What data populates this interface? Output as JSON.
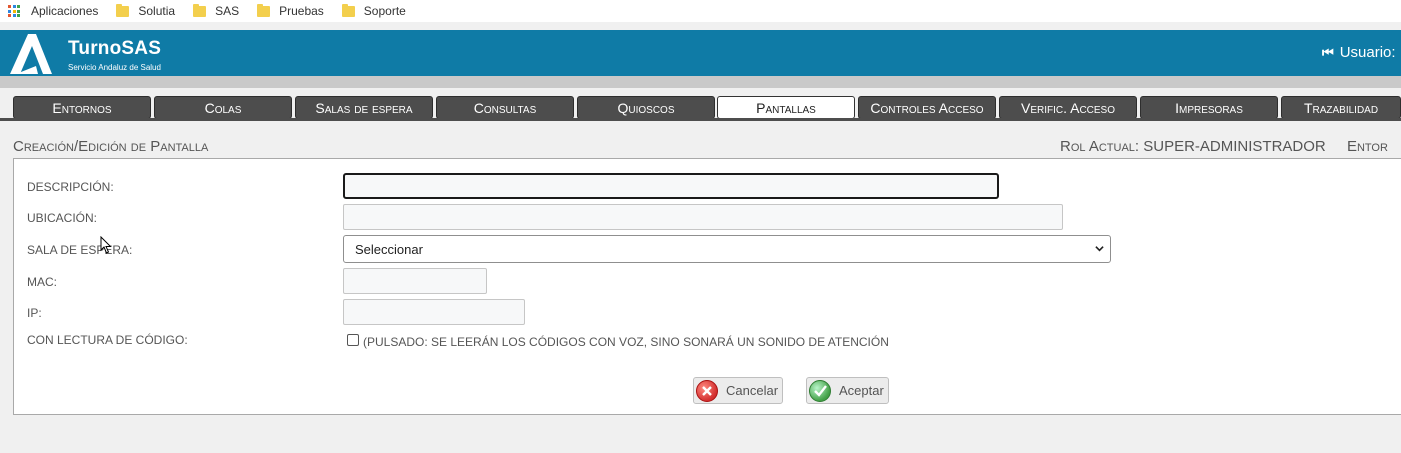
{
  "bookmarks": {
    "items": [
      {
        "label": "Aplicaciones",
        "icon": "apps-grid-icon"
      },
      {
        "label": "Solutia",
        "icon": "folder-icon"
      },
      {
        "label": "SAS",
        "icon": "folder-icon"
      },
      {
        "label": "Pruebas",
        "icon": "folder-icon"
      },
      {
        "label": "Soporte",
        "icon": "folder-icon"
      }
    ]
  },
  "header": {
    "title": "TurnoSAS",
    "subtitle": "Servicio Andaluz de Salud",
    "user_label": "Usuario:",
    "bg_color": "#0f7ba6"
  },
  "tabs": [
    {
      "label": "Entornos"
    },
    {
      "label": "Colas"
    },
    {
      "label": "Salas de espera"
    },
    {
      "label": "Consultas"
    },
    {
      "label": "Quioscos"
    },
    {
      "label": "Pantallas",
      "active": true
    },
    {
      "label": "Controles Acceso"
    },
    {
      "label": "Verific. Acceso"
    },
    {
      "label": "Impresoras"
    },
    {
      "label": "Trazabilidad"
    }
  ],
  "page": {
    "title": "Creación/Edición de Pantalla",
    "role": "Rol Actual: SUPER-ADMINISTRADOR",
    "env_truncated": "Entor"
  },
  "form": {
    "descripcion_label": "DESCRIPCIÓN:",
    "descripcion_value": "",
    "ubicacion_label": "UBICACIÓN:",
    "ubicacion_value": "",
    "sala_label": "SALA DE ESPERA:",
    "sala_value": "Seleccionar",
    "mac_label": "MAC:",
    "mac_value": "",
    "ip_label": "IP:",
    "ip_value": "",
    "lectura_label": "CON LECTURA DE CÓDIGO:",
    "lectura_checked": false,
    "lectura_text": "(PULSADO: SE LEERÁN LOS CÓDIGOS CON VOZ, SINO SONARÁ UN SONIDO DE ATENCIÓN"
  },
  "actions": {
    "cancel_label": "Cancelar",
    "accept_label": "Aceptar"
  }
}
